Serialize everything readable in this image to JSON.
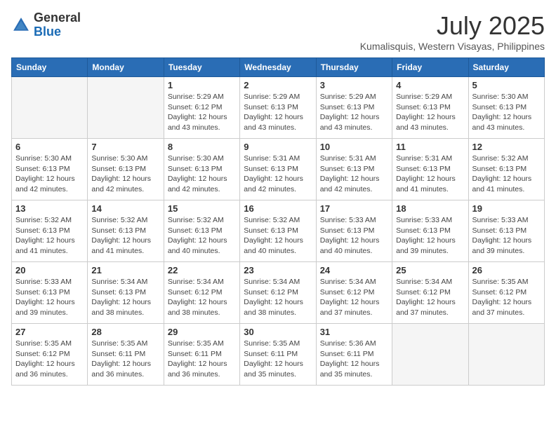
{
  "header": {
    "logo_general": "General",
    "logo_blue": "Blue",
    "month_year": "July 2025",
    "location": "Kumalisquis, Western Visayas, Philippines"
  },
  "days_of_week": [
    "Sunday",
    "Monday",
    "Tuesday",
    "Wednesday",
    "Thursday",
    "Friday",
    "Saturday"
  ],
  "weeks": [
    [
      {
        "day": "",
        "detail": ""
      },
      {
        "day": "",
        "detail": ""
      },
      {
        "day": "1",
        "detail": "Sunrise: 5:29 AM\nSunset: 6:12 PM\nDaylight: 12 hours\nand 43 minutes."
      },
      {
        "day": "2",
        "detail": "Sunrise: 5:29 AM\nSunset: 6:13 PM\nDaylight: 12 hours\nand 43 minutes."
      },
      {
        "day": "3",
        "detail": "Sunrise: 5:29 AM\nSunset: 6:13 PM\nDaylight: 12 hours\nand 43 minutes."
      },
      {
        "day": "4",
        "detail": "Sunrise: 5:29 AM\nSunset: 6:13 PM\nDaylight: 12 hours\nand 43 minutes."
      },
      {
        "day": "5",
        "detail": "Sunrise: 5:30 AM\nSunset: 6:13 PM\nDaylight: 12 hours\nand 43 minutes."
      }
    ],
    [
      {
        "day": "6",
        "detail": "Sunrise: 5:30 AM\nSunset: 6:13 PM\nDaylight: 12 hours\nand 42 minutes."
      },
      {
        "day": "7",
        "detail": "Sunrise: 5:30 AM\nSunset: 6:13 PM\nDaylight: 12 hours\nand 42 minutes."
      },
      {
        "day": "8",
        "detail": "Sunrise: 5:30 AM\nSunset: 6:13 PM\nDaylight: 12 hours\nand 42 minutes."
      },
      {
        "day": "9",
        "detail": "Sunrise: 5:31 AM\nSunset: 6:13 PM\nDaylight: 12 hours\nand 42 minutes."
      },
      {
        "day": "10",
        "detail": "Sunrise: 5:31 AM\nSunset: 6:13 PM\nDaylight: 12 hours\nand 42 minutes."
      },
      {
        "day": "11",
        "detail": "Sunrise: 5:31 AM\nSunset: 6:13 PM\nDaylight: 12 hours\nand 41 minutes."
      },
      {
        "day": "12",
        "detail": "Sunrise: 5:32 AM\nSunset: 6:13 PM\nDaylight: 12 hours\nand 41 minutes."
      }
    ],
    [
      {
        "day": "13",
        "detail": "Sunrise: 5:32 AM\nSunset: 6:13 PM\nDaylight: 12 hours\nand 41 minutes."
      },
      {
        "day": "14",
        "detail": "Sunrise: 5:32 AM\nSunset: 6:13 PM\nDaylight: 12 hours\nand 41 minutes."
      },
      {
        "day": "15",
        "detail": "Sunrise: 5:32 AM\nSunset: 6:13 PM\nDaylight: 12 hours\nand 40 minutes."
      },
      {
        "day": "16",
        "detail": "Sunrise: 5:32 AM\nSunset: 6:13 PM\nDaylight: 12 hours\nand 40 minutes."
      },
      {
        "day": "17",
        "detail": "Sunrise: 5:33 AM\nSunset: 6:13 PM\nDaylight: 12 hours\nand 40 minutes."
      },
      {
        "day": "18",
        "detail": "Sunrise: 5:33 AM\nSunset: 6:13 PM\nDaylight: 12 hours\nand 39 minutes."
      },
      {
        "day": "19",
        "detail": "Sunrise: 5:33 AM\nSunset: 6:13 PM\nDaylight: 12 hours\nand 39 minutes."
      }
    ],
    [
      {
        "day": "20",
        "detail": "Sunrise: 5:33 AM\nSunset: 6:13 PM\nDaylight: 12 hours\nand 39 minutes."
      },
      {
        "day": "21",
        "detail": "Sunrise: 5:34 AM\nSunset: 6:13 PM\nDaylight: 12 hours\nand 38 minutes."
      },
      {
        "day": "22",
        "detail": "Sunrise: 5:34 AM\nSunset: 6:12 PM\nDaylight: 12 hours\nand 38 minutes."
      },
      {
        "day": "23",
        "detail": "Sunrise: 5:34 AM\nSunset: 6:12 PM\nDaylight: 12 hours\nand 38 minutes."
      },
      {
        "day": "24",
        "detail": "Sunrise: 5:34 AM\nSunset: 6:12 PM\nDaylight: 12 hours\nand 37 minutes."
      },
      {
        "day": "25",
        "detail": "Sunrise: 5:34 AM\nSunset: 6:12 PM\nDaylight: 12 hours\nand 37 minutes."
      },
      {
        "day": "26",
        "detail": "Sunrise: 5:35 AM\nSunset: 6:12 PM\nDaylight: 12 hours\nand 37 minutes."
      }
    ],
    [
      {
        "day": "27",
        "detail": "Sunrise: 5:35 AM\nSunset: 6:12 PM\nDaylight: 12 hours\nand 36 minutes."
      },
      {
        "day": "28",
        "detail": "Sunrise: 5:35 AM\nSunset: 6:11 PM\nDaylight: 12 hours\nand 36 minutes."
      },
      {
        "day": "29",
        "detail": "Sunrise: 5:35 AM\nSunset: 6:11 PM\nDaylight: 12 hours\nand 36 minutes."
      },
      {
        "day": "30",
        "detail": "Sunrise: 5:35 AM\nSunset: 6:11 PM\nDaylight: 12 hours\nand 35 minutes."
      },
      {
        "day": "31",
        "detail": "Sunrise: 5:36 AM\nSunset: 6:11 PM\nDaylight: 12 hours\nand 35 minutes."
      },
      {
        "day": "",
        "detail": ""
      },
      {
        "day": "",
        "detail": ""
      }
    ]
  ]
}
